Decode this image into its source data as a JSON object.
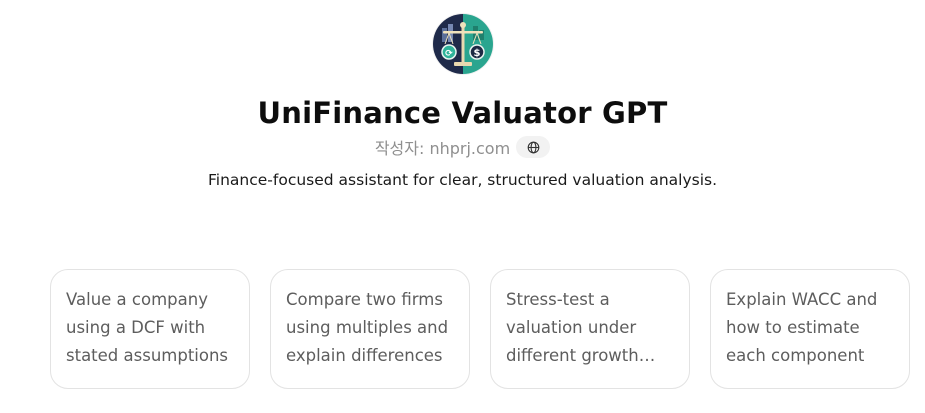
{
  "gpt": {
    "title": "UniFinance Valuator GPT",
    "author": "작성자: nhprj.com",
    "description": "Finance-focused assistant for clear, structured valuation analysis.",
    "avatar_icon": "scales-of-justice-finance-icon",
    "link_icon": "globe-icon"
  },
  "starters": [
    {
      "label": "Value a company using a DCF with stated assumptions"
    },
    {
      "label": "Compare two firms using multiples and explain differences"
    },
    {
      "label": "Stress-test a valuation under different growth assumptions"
    },
    {
      "label": "Explain WACC and how to estimate each component"
    }
  ],
  "colors": {
    "avatar_left": "#1f2a4a",
    "avatar_right": "#2aa58f",
    "card_border": "#e3e3e3",
    "card_text": "#5d5d5d",
    "muted_text": "#8f8f8f"
  }
}
